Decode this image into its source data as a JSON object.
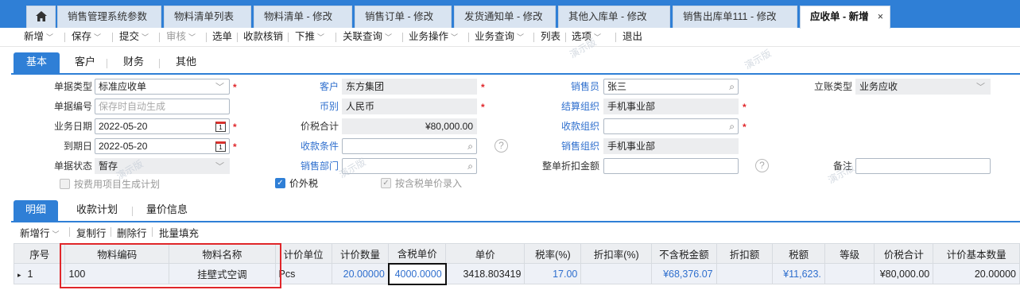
{
  "tabs": [
    {
      "label": ""
    },
    {
      "label": "销售管理系统参数"
    },
    {
      "label": "物料清单列表"
    },
    {
      "label": "物料清单 - 修改"
    },
    {
      "label": "销售订单 - 修改"
    },
    {
      "label": "发货通知单 - 修改"
    },
    {
      "label": "其他入库单 - 修改"
    },
    {
      "label": "销售出库单111 - 修改"
    },
    {
      "label": "应收单 - 新增",
      "close": "×"
    }
  ],
  "toolbar": {
    "add": "新增",
    "save": "保存",
    "submit": "提交",
    "audit": "审核",
    "select_bill": "选单",
    "verify": "收款核销",
    "push": "下推",
    "related_query": "关联查询",
    "biz_ops": "业务操作",
    "biz_query": "业务查询",
    "list": "列表",
    "options": "选项",
    "exit": "退出"
  },
  "section_tabs": {
    "basic": "基本",
    "customer": "客户",
    "finance": "财务",
    "other": "其他"
  },
  "form": {
    "bill_type": {
      "label": "单据类型",
      "value": "标准应收单"
    },
    "bill_no": {
      "label": "单据编号",
      "placeholder": "保存时自动生成"
    },
    "biz_date": {
      "label": "业务日期",
      "value": "2022-05-20"
    },
    "due_date": {
      "label": "到期日",
      "value": "2022-05-20"
    },
    "bill_status": {
      "label": "单据状态",
      "value": "暂存"
    },
    "gen_plan": {
      "label": "按费用项目生成计划"
    },
    "customer": {
      "label": "客户",
      "value": "东方集团"
    },
    "currency": {
      "label": "币别",
      "value": "人民币"
    },
    "total_tax": {
      "label": "价税合计",
      "value": "¥80,000.00"
    },
    "pay_terms": {
      "label": "收款条件",
      "value": ""
    },
    "sales_dept": {
      "label": "销售部门",
      "value": ""
    },
    "tax_excluded": {
      "label": "价外税",
      "checked": true
    },
    "tax_price_entry": {
      "label": "按含税单价录入",
      "checked": true
    },
    "salesman": {
      "label": "销售员",
      "value": "张三"
    },
    "settle_org": {
      "label": "结算组织",
      "value": "手机事业部"
    },
    "collect_org": {
      "label": "收款组织",
      "value": ""
    },
    "sales_org": {
      "label": "销售组织",
      "value": "手机事业部"
    },
    "discount_amt": {
      "label": "整单折扣金额",
      "value": ""
    },
    "account_type": {
      "label": "立账类型",
      "value": "业务应收"
    },
    "remark": {
      "label": "备注",
      "value": ""
    }
  },
  "watermark": "演示版",
  "detail_tabs": {
    "detail": "明细",
    "plan": "收款计划",
    "price": "量价信息"
  },
  "grid_toolbar": {
    "add_row": "新增行",
    "copy_row": "复制行",
    "delete_row": "删除行",
    "batch_fill": "批量填充"
  },
  "grid": {
    "headers": [
      "序号",
      "物料编码",
      "物料名称",
      "计价单位",
      "计价数量",
      "含税单价",
      "单价",
      "税率(%)",
      "折扣率(%)",
      "不含税金额",
      "折扣额",
      "税额",
      "等级",
      "价税合计",
      "计价基本数量"
    ],
    "rows": [
      [
        "1",
        "100",
        "挂壁式空调",
        "Pcs",
        "20.00000",
        "4000.0000",
        "3418.803419",
        "17.00",
        "",
        "¥68,376.07",
        "",
        "¥11,623.",
        "",
        "¥80,000.00",
        "20.00000"
      ]
    ]
  }
}
